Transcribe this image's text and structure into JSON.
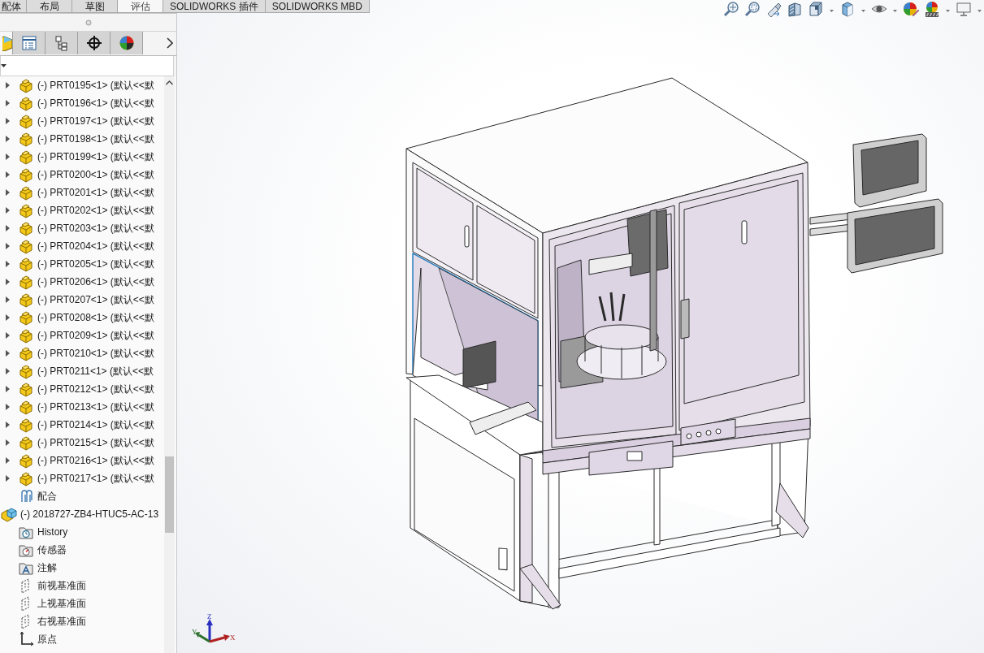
{
  "command_tabs": [
    {
      "label": "配体",
      "selected": false
    },
    {
      "label": "布局",
      "selected": false
    },
    {
      "label": "草图",
      "selected": false
    },
    {
      "label": "评估",
      "selected": true
    },
    {
      "label": "SOLIDWORKS 插件",
      "selected": false
    },
    {
      "label": "SOLIDWORKS MBD",
      "selected": false
    }
  ],
  "panel_tabs": [
    {
      "kind": "feature-tree",
      "selected": true
    },
    {
      "kind": "property",
      "selected": false
    },
    {
      "kind": "configuration",
      "selected": false
    },
    {
      "kind": "dimxpert",
      "selected": false
    },
    {
      "kind": "display",
      "selected": false
    }
  ],
  "tree": [
    {
      "kind": "part",
      "label": "(-) PRT0195<1> (默认<<默",
      "expanded": false
    },
    {
      "kind": "part",
      "label": "(-) PRT0196<1> (默认<<默",
      "expanded": false
    },
    {
      "kind": "part",
      "label": "(-) PRT0197<1> (默认<<默",
      "expanded": false
    },
    {
      "kind": "part",
      "label": "(-) PRT0198<1> (默认<<默",
      "expanded": false
    },
    {
      "kind": "part",
      "label": "(-) PRT0199<1> (默认<<默",
      "expanded": false
    },
    {
      "kind": "part",
      "label": "(-) PRT0200<1> (默认<<默",
      "expanded": false
    },
    {
      "kind": "part",
      "label": "(-) PRT0201<1> (默认<<默",
      "expanded": false
    },
    {
      "kind": "part",
      "label": "(-) PRT0202<1> (默认<<默",
      "expanded": false
    },
    {
      "kind": "part",
      "label": "(-) PRT0203<1> (默认<<默",
      "expanded": false
    },
    {
      "kind": "part",
      "label": "(-) PRT0204<1> (默认<<默",
      "expanded": false
    },
    {
      "kind": "part",
      "label": "(-) PRT0205<1> (默认<<默",
      "expanded": false
    },
    {
      "kind": "part",
      "label": "(-) PRT0206<1> (默认<<默",
      "expanded": false
    },
    {
      "kind": "part",
      "label": "(-) PRT0207<1> (默认<<默",
      "expanded": false
    },
    {
      "kind": "part",
      "label": "(-) PRT0208<1> (默认<<默",
      "expanded": false
    },
    {
      "kind": "part",
      "label": "(-) PRT0209<1> (默认<<默",
      "expanded": false
    },
    {
      "kind": "part",
      "label": "(-) PRT0210<1> (默认<<默",
      "expanded": false
    },
    {
      "kind": "part",
      "label": "(-) PRT0211<1> (默认<<默",
      "expanded": false
    },
    {
      "kind": "part",
      "label": "(-) PRT0212<1> (默认<<默",
      "expanded": false
    },
    {
      "kind": "part",
      "label": "(-) PRT0213<1> (默认<<默",
      "expanded": false
    },
    {
      "kind": "part",
      "label": "(-) PRT0214<1> (默认<<默",
      "expanded": false
    },
    {
      "kind": "part",
      "label": "(-) PRT0215<1> (默认<<默",
      "expanded": false
    },
    {
      "kind": "part",
      "label": "(-) PRT0216<1> (默认<<默",
      "expanded": false
    },
    {
      "kind": "part",
      "label": "(-) PRT0217<1> (默认<<默",
      "expanded": false
    },
    {
      "kind": "mates",
      "label": "配合"
    },
    {
      "kind": "assembly",
      "label": "(-) 2018727-ZB4-HTUC5-AC-13",
      "children": [
        {
          "kind": "history",
          "label": "History"
        },
        {
          "kind": "sensors",
          "label": "传感器"
        },
        {
          "kind": "annotations",
          "label": "注解"
        },
        {
          "kind": "plane",
          "label": "前视基准面"
        },
        {
          "kind": "plane",
          "label": "上视基准面"
        },
        {
          "kind": "plane",
          "label": "右视基准面"
        },
        {
          "kind": "origin",
          "label": "原点"
        }
      ]
    }
  ],
  "triad": {
    "z_label": "Z",
    "y_label": "Y",
    "x_label": "X"
  }
}
